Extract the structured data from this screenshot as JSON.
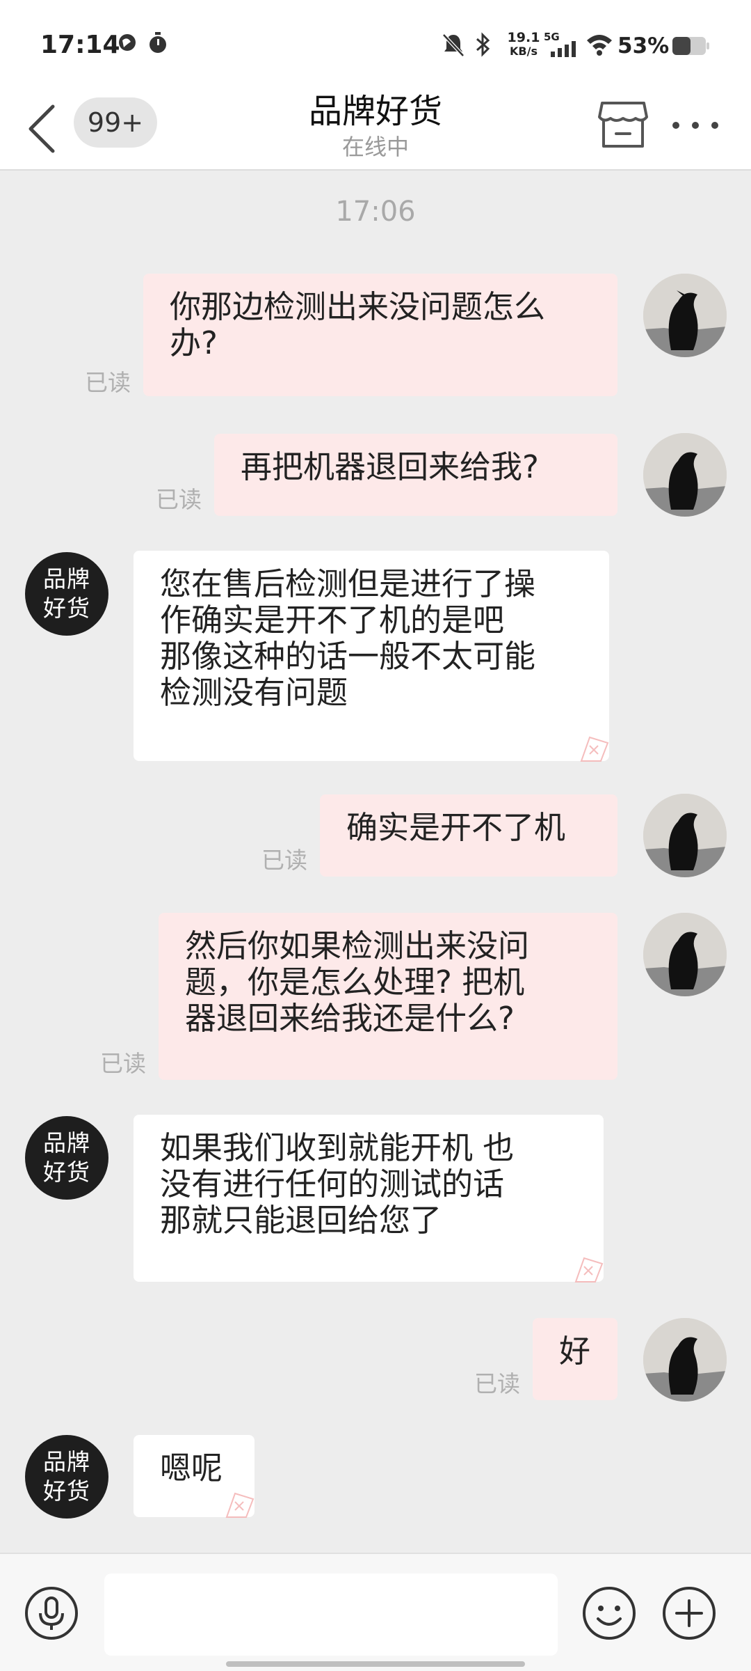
{
  "status_bar": {
    "time": "17:14",
    "net_speed_value": "19.1",
    "net_speed_unit": "KB/s",
    "network_type": "5G",
    "battery_percent": "53%"
  },
  "header": {
    "back_icon": "chevron-left-icon",
    "unread_badge": "99+",
    "title": "品牌好货",
    "subtitle": "在线中",
    "store_icon": "store-icon",
    "more_icon": "more-dots-icon"
  },
  "chat": {
    "timestamp": "17:06",
    "shop_avatar_line1": "品牌",
    "shop_avatar_line2": "好货",
    "read_label": "已读",
    "messages": [
      {
        "sender": "me",
        "lines": [
          "你那边检测出来没问题怎么",
          "办?"
        ],
        "read": "已读"
      },
      {
        "sender": "me",
        "lines": [
          "再把机器退回来给我?"
        ],
        "read": "已读"
      },
      {
        "sender": "shop",
        "lines": [
          "您在售后检测但是进行了操",
          "作确实是开不了机的是吧",
          "那像这种的话一般不太可能",
          "检测没有问题"
        ]
      },
      {
        "sender": "me",
        "lines": [
          "确实是开不了机"
        ],
        "read": "已读"
      },
      {
        "sender": "me",
        "lines": [
          "然后你如果检测出来没问",
          "题，你是怎么处理? 把机",
          "器退回来给我还是什么?"
        ],
        "read": "已读"
      },
      {
        "sender": "shop",
        "lines": [
          "如果我们收到就能开机 也",
          "没有进行任何的测试的话",
          "那就只能退回给您了"
        ]
      },
      {
        "sender": "me",
        "lines": [
          "好"
        ],
        "read": "已读"
      },
      {
        "sender": "shop",
        "lines": [
          "嗯呢"
        ]
      }
    ]
  },
  "input_bar": {
    "voice_icon": "microphone-icon",
    "placeholder": "",
    "emoji_icon": "emoji-icon",
    "plus_icon": "plus-icon"
  },
  "colors": {
    "my_bubble": "#fde9e9",
    "their_bubble": "#ffffff",
    "background": "#ededed"
  }
}
